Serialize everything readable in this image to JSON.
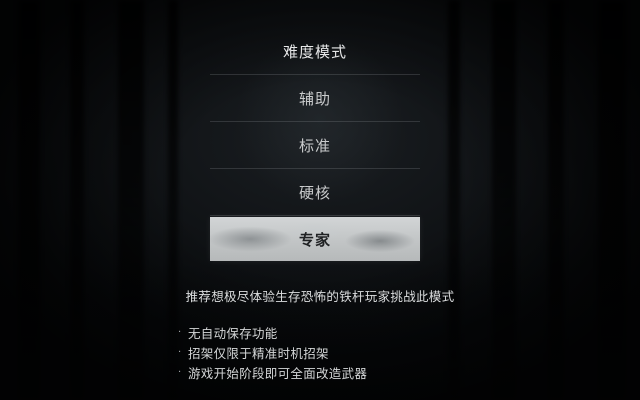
{
  "menu": {
    "title": "难度模式",
    "items": [
      {
        "label": "辅助",
        "selected": false
      },
      {
        "label": "标准",
        "selected": false
      },
      {
        "label": "硬核",
        "selected": false
      },
      {
        "label": "专家",
        "selected": true
      }
    ]
  },
  "description": "推荐想极尽体验生存恐怖的铁杆玩家挑战此模式",
  "features": [
    {
      "bullet": "·",
      "text": "无自动保存功能"
    },
    {
      "bullet": "·",
      "text": "招架仅限于精准时机招架"
    },
    {
      "bullet": "·",
      "text": "游戏开始阶段即可全面改造武器"
    }
  ],
  "colors": {
    "background": "#07090b",
    "text": "#d7d9da",
    "selected_background": "#c3c6c7",
    "selected_text": "#202224"
  }
}
